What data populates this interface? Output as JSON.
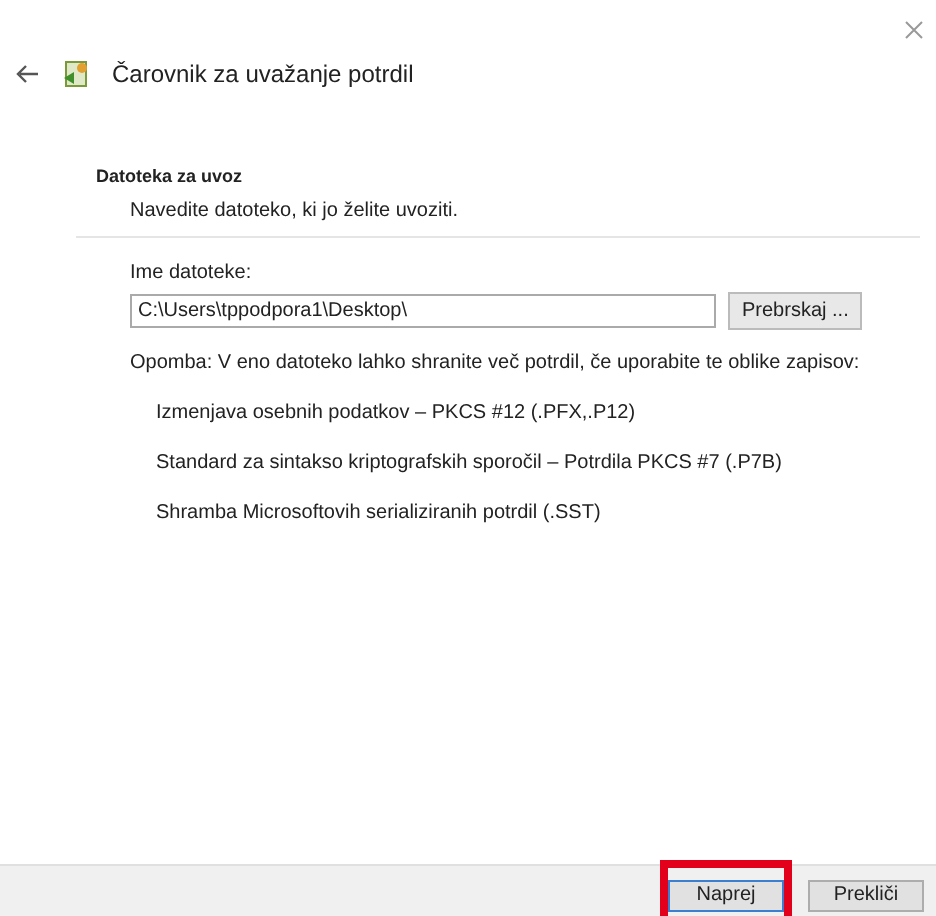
{
  "window": {
    "title": "Čarovnik za uvažanje potrdil"
  },
  "section": {
    "heading": "Datoteka za uvoz",
    "subtitle": "Navedite datoteko, ki jo želite uvoziti."
  },
  "file_field": {
    "label": "Ime datoteke:",
    "value": "C:\\Users\\tppodpora1\\Desktop\\",
    "browse_button": "Prebrskaj ..."
  },
  "note": "Opomba: V eno datoteko lahko shranite več potrdil, če uporabite te oblike zapisov:",
  "formats": [
    "Izmenjava osebnih podatkov – PKCS #12 (.PFX,.P12)",
    "Standard za sintakso kriptografskih sporočil – Potrdila PKCS #7 (.P7B)",
    "Shramba Microsoftovih serializiranih potrdil (.SST)"
  ],
  "buttons": [
    {
      "label": "Naprej",
      "highlighted": true,
      "default": true
    },
    {
      "label": "Prekliči",
      "highlighted": false,
      "default": false
    }
  ]
}
